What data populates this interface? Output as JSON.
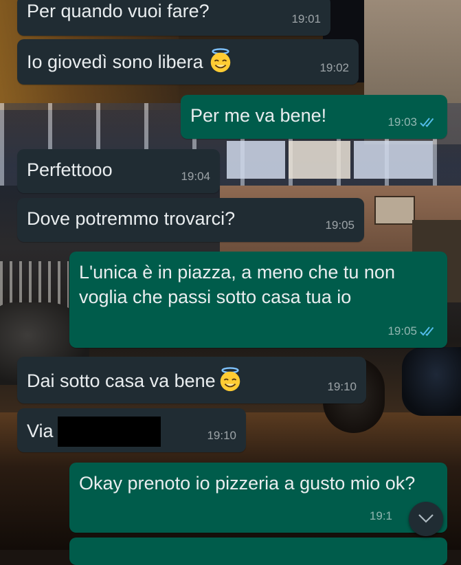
{
  "colors": {
    "incoming_bubble": "#202c33",
    "outgoing_bubble": "#005c4b",
    "read_ticks": "#53bdeb",
    "meta_text": "#9aa3a6"
  },
  "messages": [
    {
      "direction": "incoming",
      "text": "Per quando vuoi fare?",
      "time": "19:01"
    },
    {
      "direction": "incoming",
      "text": "Io giovedì sono libera",
      "emoji": "smiling-face-with-halo",
      "time": "19:02"
    },
    {
      "direction": "outgoing",
      "text": "Per me va bene!",
      "time": "19:03",
      "status": "read"
    },
    {
      "direction": "incoming",
      "text": "Perfettooo",
      "time": "19:04"
    },
    {
      "direction": "incoming",
      "text": "Dove potremmo trovarci?",
      "time": "19:05"
    },
    {
      "direction": "outgoing",
      "text": "L'unica è in piazza, a meno che tu non voglia che passi sotto casa tua io",
      "time": "19:05",
      "status": "read"
    },
    {
      "direction": "incoming",
      "text": "Dai sotto casa va bene",
      "emoji": "smiling-face-with-halo",
      "time": "19:10"
    },
    {
      "direction": "incoming",
      "text": "Via",
      "redacted": true,
      "time": "19:10"
    },
    {
      "direction": "outgoing",
      "text": "Okay prenoto io pizzeria a gusto mio ok?",
      "time": "19:1"
    }
  ],
  "scroll_button_icon": "chevron-down-icon"
}
